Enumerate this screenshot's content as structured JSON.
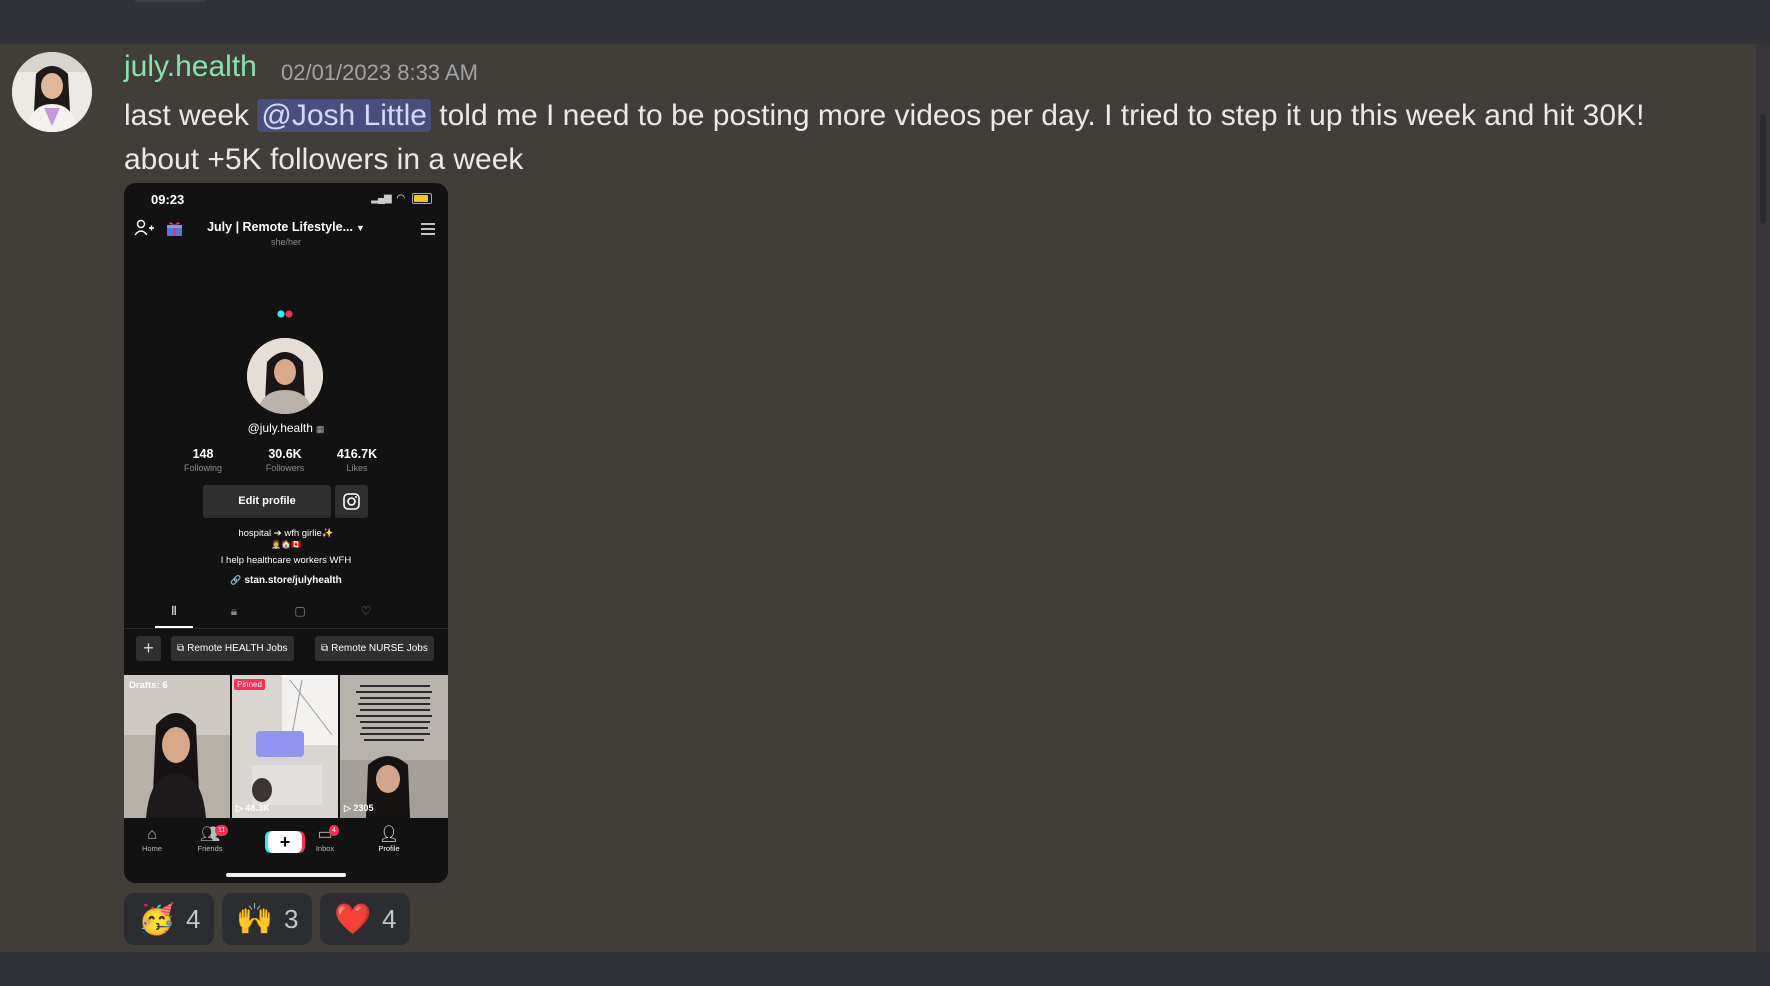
{
  "message": {
    "author": "july.health",
    "timestamp": "02/01/2023 8:33 AM",
    "text_before": "last week ",
    "mention": "@Josh Little",
    "text_after": " told me I need to be posting more videos per day. I tried to step it up this week and hit 30K! about +5K followers in a week"
  },
  "phone": {
    "status_time": "09:23",
    "profile_title": "July | Remote Lifestyle...",
    "pronouns": "she/her",
    "handle": "@july.health",
    "stats": [
      {
        "value": "148",
        "label": "Following"
      },
      {
        "value": "30.6K",
        "label": "Followers"
      },
      {
        "value": "416.7K",
        "label": "Likes"
      }
    ],
    "edit_profile": "Edit profile",
    "bio_line1": "hospital ➔ wfh girlie✨",
    "bio_line2": "👩‍⚕️🏠🇨🇦",
    "bio_line3": "I help healthcare workers WFH",
    "link": "stan.store/julyhealth",
    "playlists": [
      "Remote HEALTH Jobs",
      "Remote NURSE Jobs"
    ],
    "thumbnails": [
      {
        "label": "Drafts: 6",
        "views": ""
      },
      {
        "label": "Pinned",
        "views": "48.3K"
      },
      {
        "label": "",
        "views": "2305"
      }
    ],
    "nav": [
      {
        "label": "Home",
        "badge": ""
      },
      {
        "label": "Friends",
        "badge": "11"
      },
      {
        "label": "",
        "badge": ""
      },
      {
        "label": "Inbox",
        "badge": "4"
      },
      {
        "label": "Profile",
        "badge": ""
      }
    ]
  },
  "reactions": [
    {
      "emoji": "🥳",
      "count": "4"
    },
    {
      "emoji": "🙌",
      "count": "3"
    },
    {
      "emoji": "❤️",
      "count": "4"
    }
  ],
  "colors": {
    "author": "#86e3b0",
    "mention_bg": "#4a4d80",
    "message_bg": "#413e39",
    "tiktok_red": "#fe2c55",
    "tiktok_cyan": "#25f4ee"
  }
}
